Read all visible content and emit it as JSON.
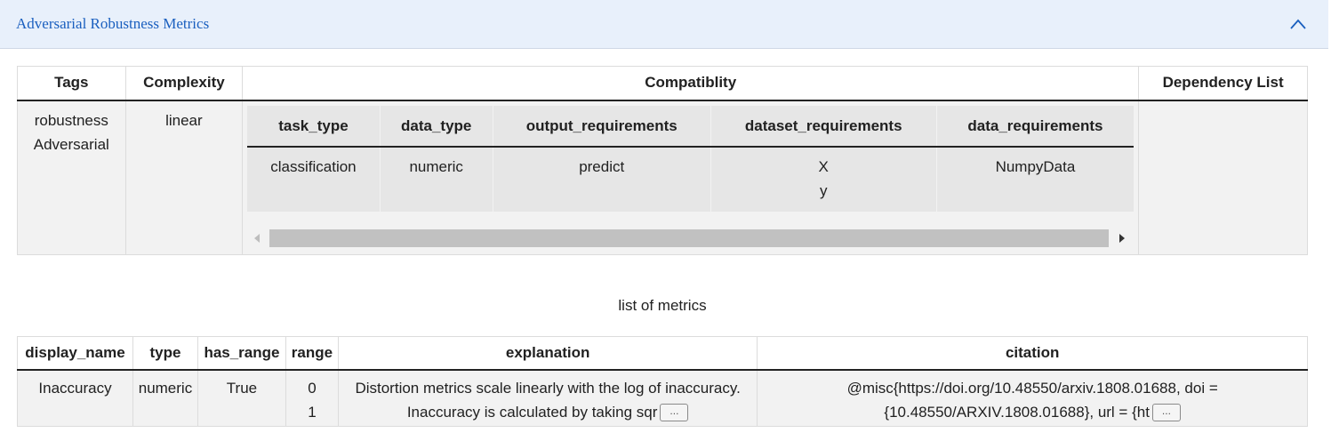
{
  "panel": {
    "title": "Adversarial Robustness Metrics",
    "collapse_icon": "chevron-up-icon"
  },
  "main_table": {
    "headers": [
      "Tags",
      "Complexity",
      "Compatiblity",
      "Dependency List"
    ],
    "row": {
      "tags": [
        "robustness",
        "Adversarial"
      ],
      "complexity": "linear",
      "compatibility": {
        "headers": [
          "task_type",
          "data_type",
          "output_requirements",
          "dataset_requirements",
          "data_requirements"
        ],
        "row": {
          "task_type": "classification",
          "data_type": "numeric",
          "output_requirements": "predict",
          "dataset_requirements": [
            "X",
            "y"
          ],
          "data_requirements": "NumpyData"
        }
      },
      "dependency_list": ""
    }
  },
  "metrics": {
    "title": "list of metrics",
    "headers": [
      "display_name",
      "type",
      "has_range",
      "range",
      "explanation",
      "citation"
    ],
    "row": {
      "display_name": "Inaccuracy",
      "type": "numeric",
      "has_range": "True",
      "range": [
        "0",
        "1"
      ],
      "explanation_lines": [
        "Distortion metrics scale linearly with the log of inaccuracy.",
        "Inaccuracy is calculated by taking sqr"
      ],
      "citation_lines": [
        "@misc{https://doi.org/10.48550/arxiv.1808.01688, doi =",
        "{10.48550/ARXIV.1808.01688}, url = {ht"
      ],
      "more_label": "..."
    }
  }
}
